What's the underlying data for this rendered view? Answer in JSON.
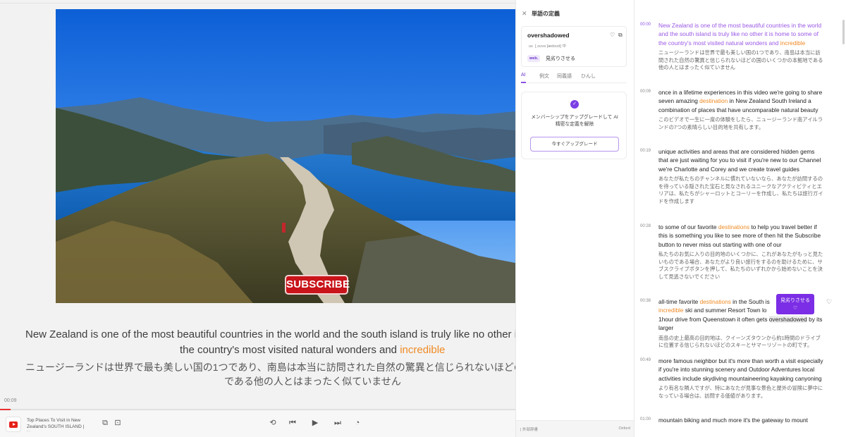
{
  "colors": {
    "accent": "#7b2ee5",
    "highlight": "#f08a24",
    "progress": "#e83232"
  },
  "video": {
    "subscribe_label": "SUBSCRIBE",
    "subtitle_en_1": "New Zealand is one of the most beautiful countries in the world and the south island is truly like no other it is",
    "subtitle_en_2a": "the country's most visited natural wonders and ",
    "subtitle_en_2b": "incredible",
    "subtitle_ja_1": "ニュージーランドは世界で最も美しい国の1つであり、南島は本当に訪問された自然の驚異と信じられないほどの国の",
    "subtitle_ja_2": "である他の人とはまったく似ていません",
    "current_time": "00:09",
    "progress": 0.02
  },
  "player": {
    "title": "Top Places To Visit in New Zealand's SOUTH ISLAND | Ne...",
    "icons": [
      "youtube-logo-icon",
      "pip-icon",
      "caption-icon",
      "loop-icon",
      "previous-icon",
      "play-icon",
      "next-icon",
      "speed-icon"
    ]
  },
  "dictionary": {
    "title": "単語の定義",
    "word": "overshadowed",
    "region": "us",
    "phonetic": "[ˌoʊvəˈʃædoʊd] 中",
    "web_tag": "web.",
    "web_definition": "見劣りさせる",
    "tabs": [
      "AI",
      "例文",
      "同義語",
      "ひんし"
    ],
    "ai_message": "メンバーシップをアップグレードして AI 精密な定義を解除",
    "upgrade_button": "今すぐアップグレード",
    "footer_left": "| 外部辞書",
    "footer_right": "Oxford"
  },
  "transcript": {
    "popup_label": "見劣りさせる",
    "popup_icon": "♡",
    "segments": [
      {
        "time": "00:00",
        "en_parts": [
          "New Zealand is one of the most beautiful countries in the world and the south island is truly like no other it is home to some of the country's most visited natural wonders and ",
          "incredible"
        ],
        "ja": "ニュージーランドは世界で最も美しい国の1つであり、南島は本当に訪問された自然の驚異と信じられないほどの国のいくつかの本拠地である他の人とはまったく似ていません"
      },
      {
        "time": "00:09",
        "en_parts": [
          "once in a lifetime experiences in this video we're going to share seven amazing ",
          "destination",
          " in New Zealand South Ireland a combination of places that have uncomparable natural beauty"
        ],
        "ja": "このビデオで一生に一度の体験をしたら、ニュージーランド南アイルランドの7つの素晴らしい目的地を共有します。"
      },
      {
        "time": "00:19",
        "en_parts": [
          "unique activities and areas that are considered hidden gems that are just waiting for you to visit if you're new to our Channel we're Charlotte and Corey and we create travel guides"
        ],
        "ja": "あなたが私たちのチャンネルに慣れていないなら、あなたが訪問するのを待っている隠された宝石と見なされるユニークなアクティビティとエリアは、私たちがシャーロットとコーリーを作成し、私たちは旅行ガイドを作成します"
      },
      {
        "time": "00:28",
        "en_parts": [
          "to some of our favorite ",
          "destinations",
          " to help you travel better if this is something you like to see more of then hit the Subscribe button to never miss out starting with one of our"
        ],
        "ja": "私たちのお気に入りの目的地のいくつかに、これがあなたがもっと見たいものである場合、あなたがより良い旅行をするのを助けるために、サブスクライブボタンを押して、私たちのいずれかから始めないことを決して見逃さないでください"
      },
      {
        "time": "00:38",
        "en_parts": [
          "all-time favorite ",
          "destinations",
          " in the South is ",
          "incredible",
          " ski and summer Resort Town lo",
          "1hour drive from Queenstown it often gets ",
          "overshadowed",
          " by its larger"
        ],
        "ja": "南島の史上最高の目的地は、クイーンズタウンから約1時間のドライブに位置する信じられないほどのスキーとサマーリゾートの町です。"
      },
      {
        "time": "00:49",
        "en_parts": [
          "more famous neighbor but it's more than worth a visit especially if you're into stunning scenery and Outdoor Adventures local activities include skydiving mountaineering kayaking canyoning"
        ],
        "ja": "より有名な隣人ですが、特にあなたが見事な景色と屋外の冒険に夢中になっている場合は、訪問する価値があります。"
      },
      {
        "time": "01:00",
        "en_parts": [
          "mountain biking and much more it's the gateway to mount"
        ],
        "ja": ""
      }
    ]
  }
}
